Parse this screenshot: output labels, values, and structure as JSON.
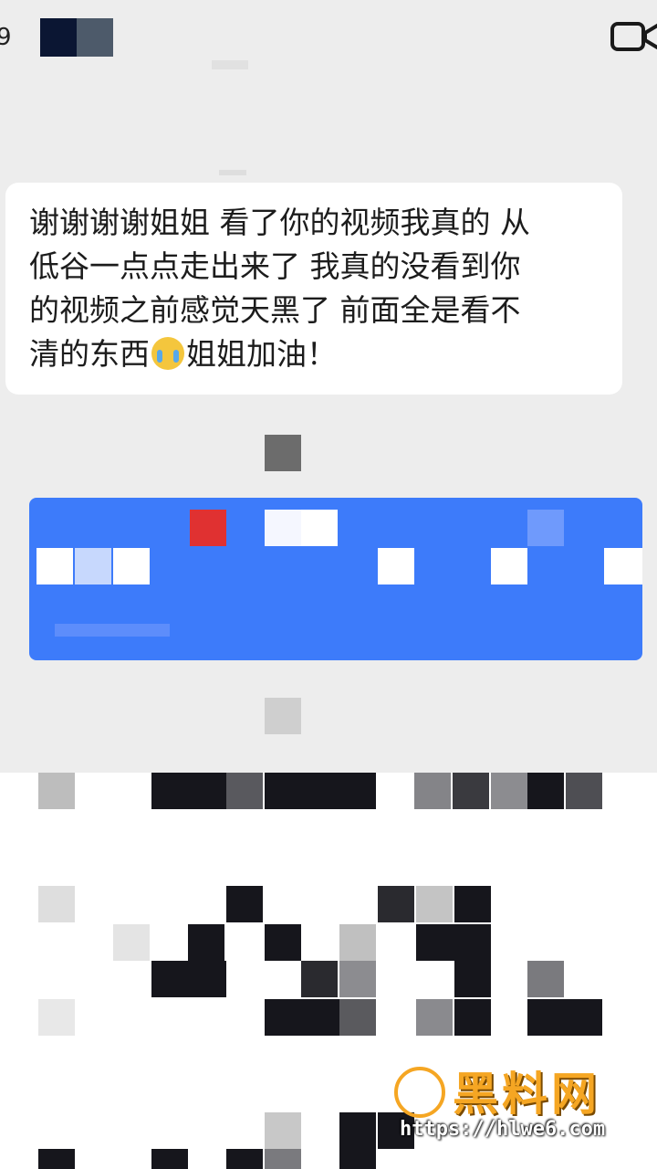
{
  "header": {
    "back_glyph": "9",
    "title_obscured": true,
    "video_call_icon": "video-camera-icon"
  },
  "message": {
    "line1": "谢谢谢谢姐姐 看了你的视频我真的 从",
    "line2": "低谷一点点走出来了 我真的没看到你",
    "line3": "的视频之前感觉天黑了 前面全是看不",
    "line4_before": "清的东西",
    "emoji": "loudly-crying-face-emoji",
    "line4_after": "姐姐加油！"
  },
  "watermark": {
    "title": "黑料网",
    "url": "https://hlwe6.com"
  },
  "colors": {
    "background": "#ededed",
    "bubble": "#ffffff",
    "card_blue": "#3d7bfa",
    "watermark_orange": "#f5a623"
  }
}
